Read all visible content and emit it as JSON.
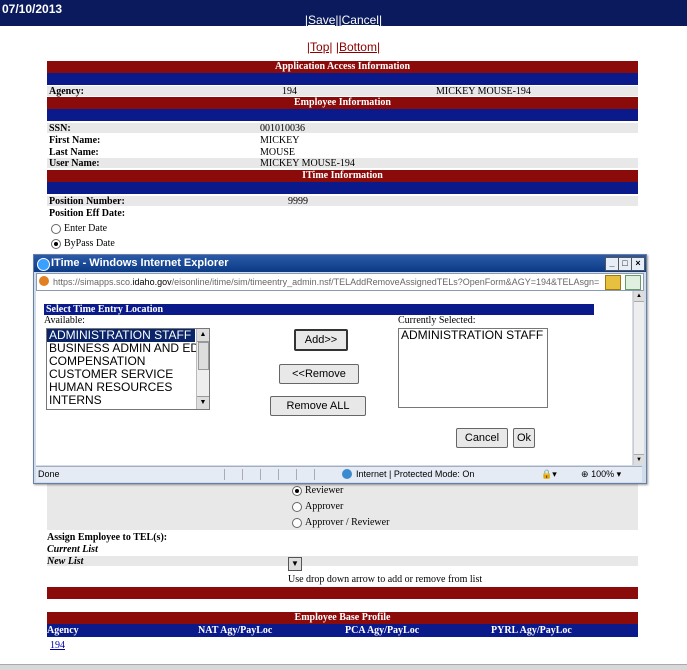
{
  "header": {
    "date": "07/10/2013",
    "save": "|Save|",
    "cancel": "|Cancel|",
    "top": "|Top|",
    "bottom": "|Bottom|"
  },
  "app_access": {
    "title": "Application Access Information",
    "agency_label": "Agency:",
    "agency_code": "194",
    "agency_name": "MICKEY MOUSE-194"
  },
  "employee": {
    "title": "Employee Information",
    "ssn_label": "SSN:",
    "ssn": "001010036",
    "first_label": "First Name:",
    "first": "MICKEY",
    "last_label": "Last Name:",
    "last": "MOUSE",
    "user_label": "User Name:",
    "user": "MICKEY MOUSE-194"
  },
  "itime": {
    "title": "ITime Information",
    "position_label": "Position Number:",
    "position": "9999",
    "eff_label": "Position Eff Date:",
    "enter_date": "Enter Date",
    "bypass_date": "ByPass Date"
  },
  "popup": {
    "title": "ITime - Windows Internet Explorer",
    "url_pre": "https://simapps.sco.",
    "url_host": "idaho.gov",
    "url_post": "/eisonline/itime/sim/timeentry_admin.nsf/TELAddRemoveAssignedTELs?OpenForm&AGY=194&TELAsgn=",
    "section_title": "Select Time Entry Location",
    "available_label": "Available:",
    "selected_label": "Currently Selected:",
    "available": [
      "ADMINISTRATION STAFF",
      "BUSINESS ADMIN AND ED",
      "COMPENSATION",
      "CUSTOMER SERVICE",
      "HUMAN RESOURCES",
      "INTERNS"
    ],
    "selected": [
      "ADMINISTRATION STAFF"
    ],
    "add": "Add>>",
    "remove": "<<Remove",
    "remove_all": "Remove ALL",
    "cancel": "Cancel",
    "ok": "Ok",
    "status_done": "Done",
    "status_zone": "Internet | Protected Mode: On",
    "zoom": "100%"
  },
  "roles": {
    "reviewer": "Reviewer",
    "approver": "Approver",
    "approver_reviewer": "Approver / Reviewer"
  },
  "assign": {
    "title": "Assign Employee to TEL(s):",
    "current": "Current List",
    "new": "New List",
    "hint": "Use drop down arrow to add or remove from list"
  },
  "base_profile": {
    "title": "Employee Base Profile",
    "col_agency": "Agency",
    "col_nat": "NAT Agy/PayLoc",
    "col_pca": "PCA Agy/PayLoc",
    "col_pyrl": "PYRL Agy/PayLoc",
    "agency_link": "194"
  }
}
